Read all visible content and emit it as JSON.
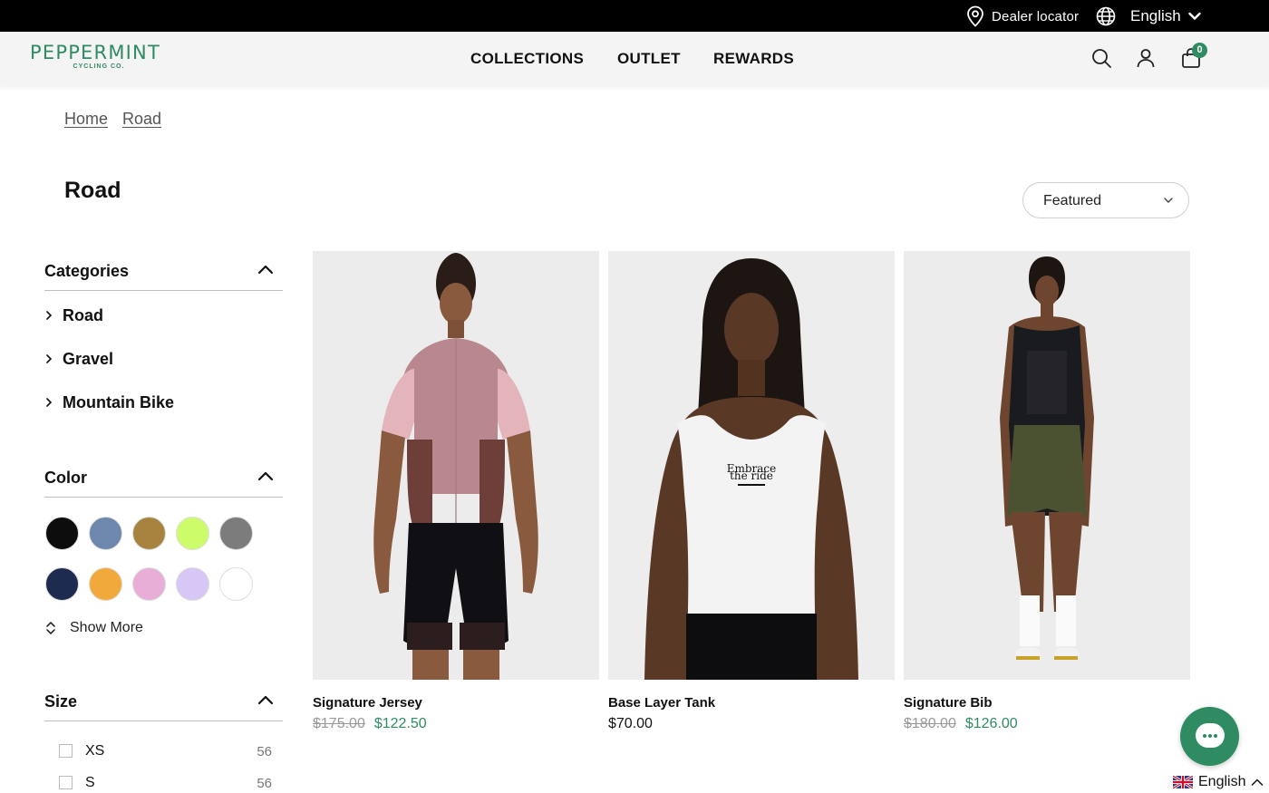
{
  "topbar": {
    "dealer_locator": "Dealer locator",
    "language": "English"
  },
  "header": {
    "logo_main": "PEPPERMINT",
    "logo_sub": "CYCLING CO.",
    "nav": [
      "COLLECTIONS",
      "OUTLET",
      "REWARDS"
    ],
    "cart_count": "0"
  },
  "breadcrumb": [
    "Home",
    "Road"
  ],
  "page_title": "Road",
  "sort": {
    "selected": "Featured"
  },
  "filters": {
    "categories": {
      "title": "Categories",
      "items": [
        "Road",
        "Gravel",
        "Mountain Bike"
      ]
    },
    "color": {
      "title": "Color",
      "swatches": [
        "#0d0d0d",
        "#6e87ad",
        "#a8833f",
        "#cdfc6b",
        "#7c7c7c",
        "#1d2b51",
        "#f2a93b",
        "#e8aed8",
        "#d6c7f7",
        "#ffffff"
      ],
      "show_more": "Show More"
    },
    "size": {
      "title": "Size",
      "options": [
        {
          "label": "XS",
          "count": "56"
        },
        {
          "label": "S",
          "count": "56"
        }
      ]
    }
  },
  "products": [
    {
      "name": "Signature Jersey",
      "price_original": "$175.00",
      "price_sale": "$122.50"
    },
    {
      "name": "Base Layer Tank",
      "price": "$70.00"
    },
    {
      "name": "Signature Bib",
      "price_original": "$180.00",
      "price_sale": "$126.00"
    }
  ],
  "product_print": {
    "line1": "Embrace",
    "line2": "the ride"
  },
  "footer_language": "English",
  "colors": {
    "brand": "#2f8b62",
    "topbar": "#000000"
  }
}
